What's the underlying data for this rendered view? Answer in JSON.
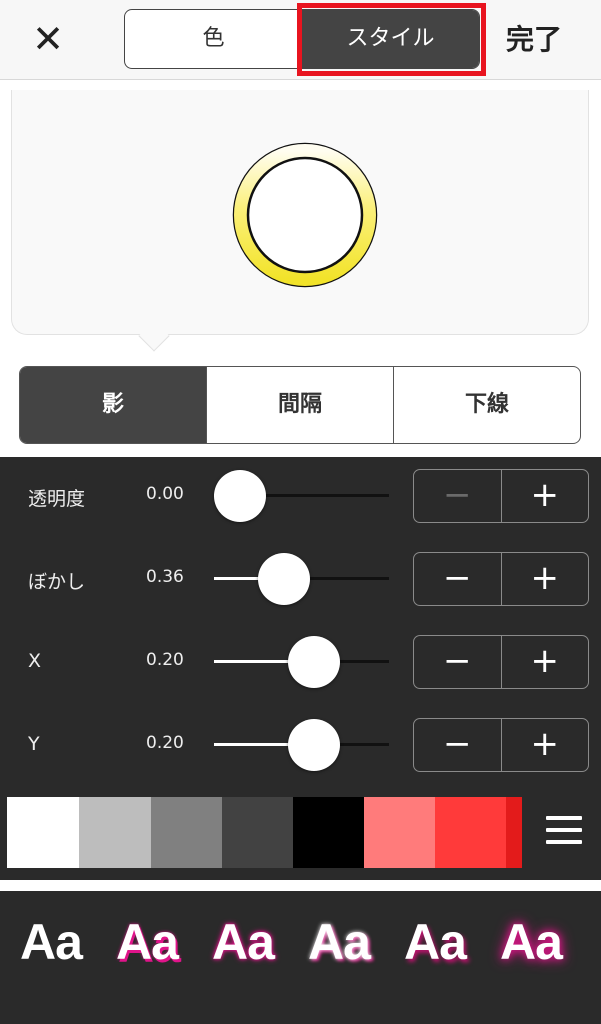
{
  "topbar": {
    "close_glyph": "✕",
    "tabs": [
      "色",
      "スタイル"
    ],
    "done_label": "完了"
  },
  "preview": {
    "ring_gradient": [
      "#f2e32a",
      "#fffdf0"
    ]
  },
  "subtabs": [
    "影",
    "間隔",
    "下線"
  ],
  "sliders": [
    {
      "label": "透明度",
      "value": "0.00",
      "fraction": 0.0
    },
    {
      "label": "ぼかし",
      "value": "0.36",
      "fraction": 0.36
    },
    {
      "label": "X",
      "value": "0.20",
      "fraction": 0.6
    },
    {
      "label": "Y",
      "value": "0.20",
      "fraction": 0.6
    }
  ],
  "stepper": {
    "minus": "−",
    "plus": "+"
  },
  "swatch_colors": [
    "#ffffff",
    "#bdbdbd",
    "#808080",
    "#424242",
    "#000000",
    "#ff7b7b",
    "#ff3a3a",
    "#e31b1b"
  ],
  "font_styles": [
    "Aa",
    "Aa",
    "Aa",
    "Aa",
    "Aa",
    "Aa"
  ],
  "colors": {
    "accent_highlight": "#e8141f",
    "panel": "#2a2a2a",
    "shadow_pink": "#e0148a"
  }
}
